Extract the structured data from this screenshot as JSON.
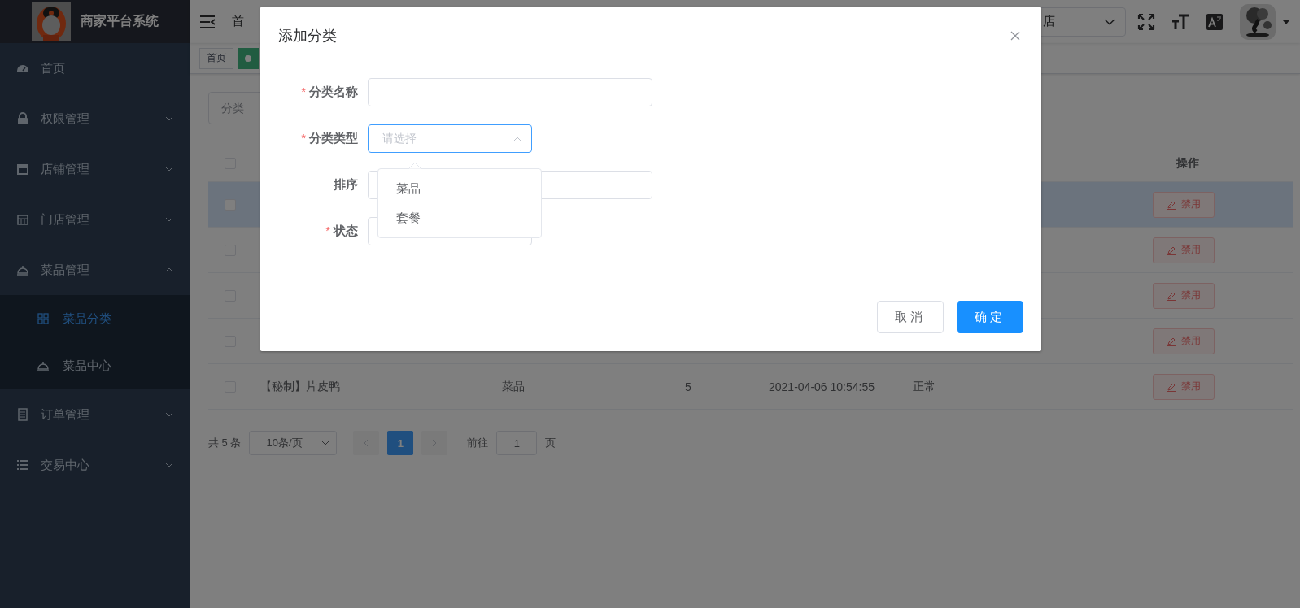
{
  "sidebar": {
    "title": "商家平台系统",
    "items": [
      {
        "label": "首页",
        "selected": false
      },
      {
        "label": "权限管理",
        "selected": false,
        "expanded": false
      },
      {
        "label": "店铺管理",
        "selected": false,
        "expanded": false
      },
      {
        "label": "门店管理",
        "selected": false,
        "expanded": false
      },
      {
        "label": "菜品管理",
        "selected": false,
        "expanded": true,
        "children": [
          {
            "label": "菜品分类",
            "selected": true
          },
          {
            "label": "菜品中心",
            "selected": false
          }
        ]
      },
      {
        "label": "订单管理",
        "selected": false,
        "expanded": false
      },
      {
        "label": "交易中心",
        "selected": false,
        "expanded": false
      }
    ]
  },
  "header": {
    "breadcrumb": "首",
    "store_select": {
      "value": "店"
    }
  },
  "tags": [
    {
      "label": "首页",
      "selected": false
    },
    {
      "selected": true
    }
  ],
  "search": {
    "placeholder": "分类"
  },
  "table": {
    "action_header": "操作",
    "header_checked": false,
    "rows": [
      {
        "checked": false,
        "hovered": true,
        "action": "禁用"
      },
      {
        "checked": false,
        "hovered": false,
        "action": "禁用"
      },
      {
        "checked": false,
        "hovered": false,
        "action": "禁用"
      },
      {
        "checked": false,
        "hovered": false,
        "action": "禁用"
      },
      {
        "checked": false,
        "hovered": false,
        "cells": [
          "【秘制】片皮鸭",
          "菜品",
          "5",
          "2021-04-06 10:54:55",
          "正常"
        ],
        "action": "禁用"
      }
    ]
  },
  "pagination": {
    "total": "共 5 条",
    "page_size": "10条/页",
    "pages": [
      {
        "label": "1",
        "selected": true
      }
    ],
    "goto_label": "前往",
    "goto_value": "1",
    "goto_suffix": "页"
  },
  "modal": {
    "title": "添加分类",
    "fields": [
      {
        "label": "分类名称",
        "required_mark": "*",
        "kind": "input"
      },
      {
        "label": "分类类型",
        "required_mark": "*",
        "kind": "select",
        "placeholder": "请选择",
        "expanded": true
      },
      {
        "label": "排序",
        "kind": "input"
      },
      {
        "label": "状态",
        "required_mark": "*",
        "kind": "select",
        "expanded": false
      }
    ],
    "dropdown": {
      "options": [
        {
          "label": "菜品",
          "selected": false
        },
        {
          "label": "套餐",
          "selected": false
        }
      ]
    },
    "buttons": [
      {
        "label": "取消",
        "kind": "default"
      },
      {
        "label": "确定",
        "kind": "primary"
      }
    ]
  }
}
